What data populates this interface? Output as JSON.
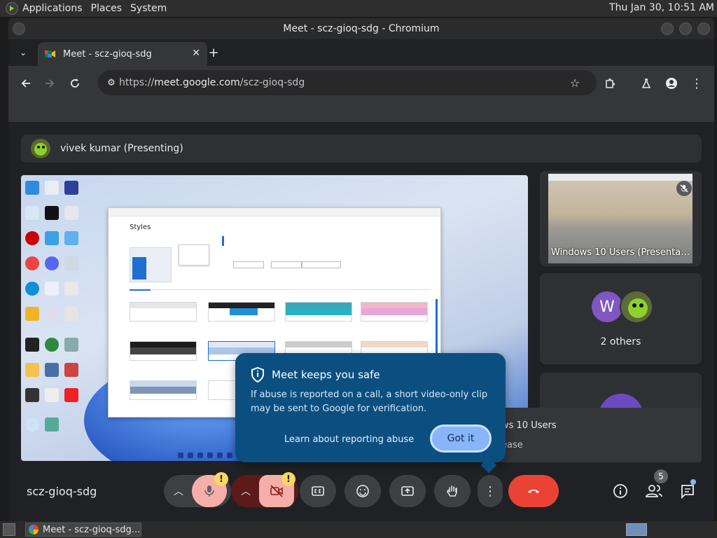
{
  "panel": {
    "menus": [
      "Applications",
      "Places",
      "System"
    ],
    "clock": "Thu Jan 30, 10:51 AM"
  },
  "window": {
    "title": "Meet - scz-gioq-sdg - Chromium"
  },
  "browser": {
    "tab_title": "Meet - scz-gioq-sdg",
    "new_tab": "+",
    "url_scheme": "https://",
    "url_host": "meet.google.com",
    "url_path": "/scz-gioq-sdg"
  },
  "meet": {
    "presenter_label": "vivek kumar (Presenting)",
    "presented_app_title": "Styles",
    "tiles": {
      "windows_users_label": "Windows 10 Users (Presenta…",
      "others_initial": "W",
      "others_label": "2 others",
      "floating_line1": "ws 10 Users",
      "floating_line2": "ease"
    },
    "popup": {
      "title": "Meet keeps you safe",
      "body": "If abuse is reported on a call, a short video-only clip may be sent to Google for verification.",
      "learn_link": "Learn about reporting abuse",
      "got_it": "Got it"
    },
    "meeting_code": "scz-gioq-sdg",
    "warn_mark": "!",
    "participants_count": "5"
  },
  "os_taskbar": {
    "window_item": "Meet - scz-gioq-sdg..."
  },
  "colors": {
    "meet_bg": "#202124",
    "popup_bg": "#0b4f80",
    "got_it_bg": "#8ab4f8",
    "end_call": "#ea4335",
    "warning": "#fdd663"
  }
}
